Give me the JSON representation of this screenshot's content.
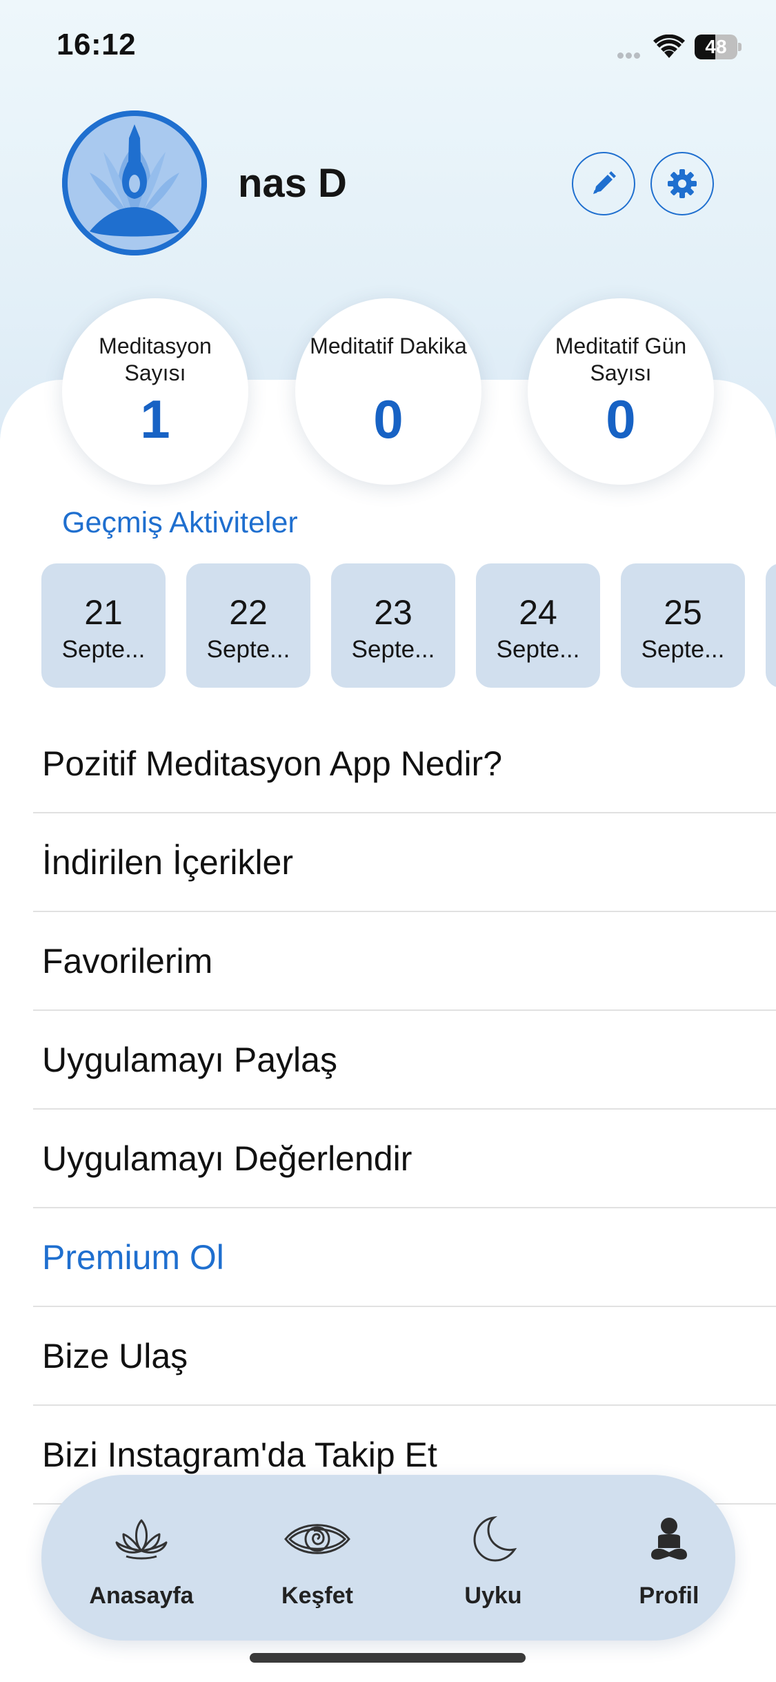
{
  "status_bar": {
    "time": "16:12",
    "battery_level": "48",
    "battery_fraction": 0.48
  },
  "profile": {
    "user_name": "nas D",
    "edit_icon": "pencil-icon",
    "settings_icon": "gear-icon"
  },
  "stats": [
    {
      "label": "Meditasyon Sayısı",
      "value": "1"
    },
    {
      "label": "Meditatif Dakika",
      "value": "0"
    },
    {
      "label": "Meditatif Gün Sayısı",
      "value": "0"
    }
  ],
  "history": {
    "title": "Geçmiş Aktiviteler",
    "days": [
      {
        "day": "21",
        "month": "Septe..."
      },
      {
        "day": "22",
        "month": "Septe..."
      },
      {
        "day": "23",
        "month": "Septe..."
      },
      {
        "day": "24",
        "month": "Septe..."
      },
      {
        "day": "25",
        "month": "Septe..."
      },
      {
        "day": "",
        "month": ""
      }
    ]
  },
  "menu": {
    "items": [
      {
        "label": "Pozitif Meditasyon App Nedir?"
      },
      {
        "label": "İndirilen İçerikler"
      },
      {
        "label": "Favorilerim"
      },
      {
        "label": "Uygulamayı Paylaş"
      },
      {
        "label": "Uygulamayı Değerlendir"
      },
      {
        "label": "Premium Ol"
      },
      {
        "label": "Bize Ulaş"
      },
      {
        "label": "Bizi Instagram'da Takip Et"
      }
    ]
  },
  "tab_bar": {
    "tabs": [
      {
        "label": "Anasayfa",
        "icon": "lotus-icon"
      },
      {
        "label": "Keşfet",
        "icon": "eye-spiral-icon"
      },
      {
        "label": "Uyku",
        "icon": "moon-icon"
      },
      {
        "label": "Profil",
        "icon": "meditating-person-icon"
      }
    ]
  },
  "colors": {
    "accent": "#1f6fcf",
    "card": "#d1dfee",
    "tab_bar": "#d1dfee"
  }
}
